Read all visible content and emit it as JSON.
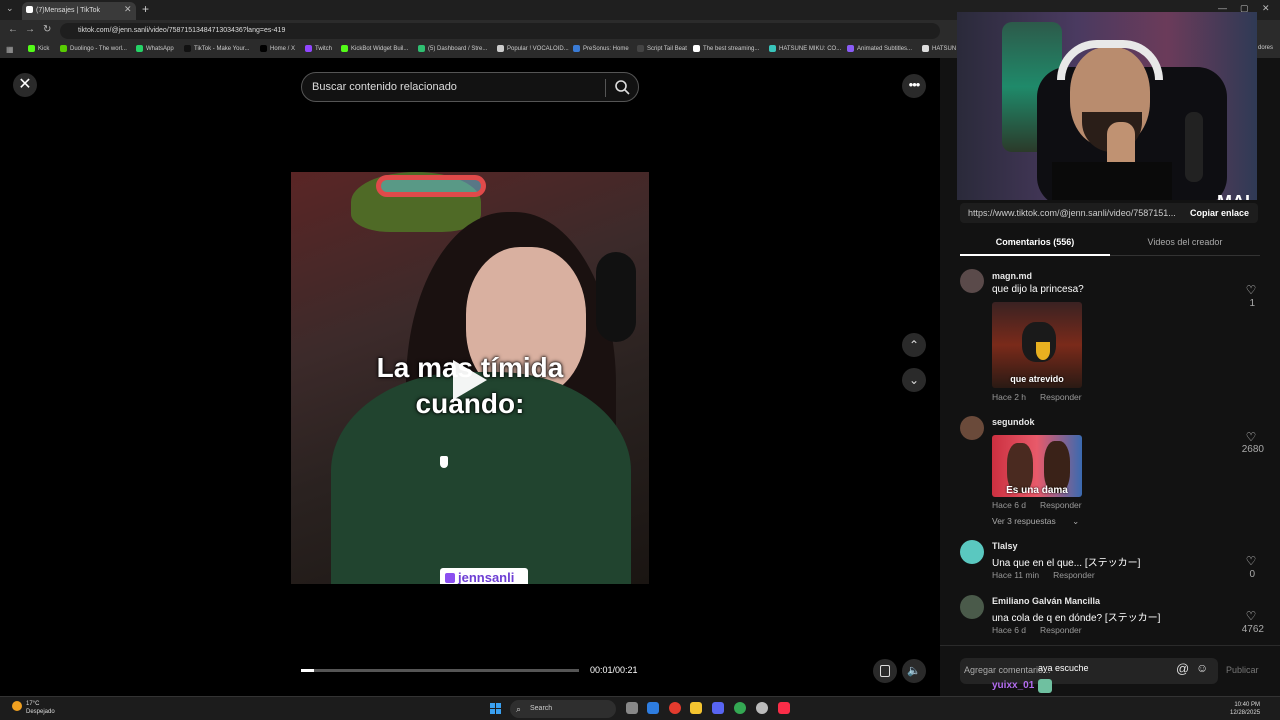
{
  "browser": {
    "tab_title": "(7)Mensajes | TikTok",
    "url": "tiktok.com/@jenn.sanli/video/7587151348471303436?lang=es-419",
    "bookmarks": [
      {
        "label": "Kick",
        "color": "#53fc18"
      },
      {
        "label": "Duolingo - The worl...",
        "color": "#58cc02"
      },
      {
        "label": "WhatsApp",
        "color": "#25d366"
      },
      {
        "label": "TikTok - Make Your...",
        "color": "#111111"
      },
      {
        "label": "Home / X",
        "color": "#000000"
      },
      {
        "label": "Twitch",
        "color": "#9146ff"
      },
      {
        "label": "KickBot Widget Buil...",
        "color": "#53fc18"
      },
      {
        "label": "(5) Dashboard / Stre...",
        "color": "#2fbf71"
      },
      {
        "label": "Popular ! VOCALOID...",
        "color": "#cccccc"
      },
      {
        "label": "PreSonus: Home",
        "color": "#3a7bd5"
      },
      {
        "label": "Script Tail Beat",
        "color": "#444444"
      },
      {
        "label": "The best streaming...",
        "color": "#ffffff"
      },
      {
        "label": "HATSUNE MIKU: CO...",
        "color": "#39c5bb"
      },
      {
        "label": "Animated Subtitles...",
        "color": "#8a5cf6"
      },
      {
        "label": "HATSUN",
        "color": "#dddddd"
      }
    ],
    "bookmarks_overflow": "dores"
  },
  "page": {
    "search_placeholder": "Buscar contenido relacionado",
    "video_caption_line1": "La mas tímida",
    "video_caption_line2": "cuando:",
    "watermark": "jennsanli",
    "time": "00:01/00:21",
    "progress": 0.045
  },
  "webcam_logo": "MAI",
  "panel": {
    "link": "https://www.tiktok.com/@jenn.sanli/video/7587151...",
    "copy_label": "Copiar enlace",
    "tab_comments": "Comentarios (556)",
    "tab_creator": "Videos del creador",
    "comments": [
      {
        "user": "magn.md",
        "text": "que dijo la princesa?",
        "time": "Hace 2 h",
        "reply": "Responder",
        "likes": "1",
        "gif_caption": "que atrevido"
      },
      {
        "user": "segundok",
        "text": "",
        "time": "Hace 6 d",
        "reply": "Responder",
        "likes": "2680",
        "gif_caption": "Es una dama",
        "replies_label": "Ver 3 respuestas"
      },
      {
        "user": "Tlalsy",
        "text": "Una que en el que... [ステッカー]",
        "time": "Hace 11 min",
        "reply": "Responder",
        "likes": "0"
      },
      {
        "user": "Emiliano Galván Mancilla",
        "text": "una cola de q en dónde? [ステッカー]",
        "time": "Hace 6 d",
        "reply": "Responder",
        "likes": "4762"
      }
    ],
    "composer_placeholder": "Agregar comentario...",
    "composer_typed": "aya escuche",
    "composer_overlay_user": "yuixx_01",
    "publish_label": "Publicar"
  },
  "taskbar": {
    "temp": "17°C",
    "weather": "Despejado",
    "search": "Search",
    "time": "10:40 PM",
    "date": "12/28/2025"
  }
}
